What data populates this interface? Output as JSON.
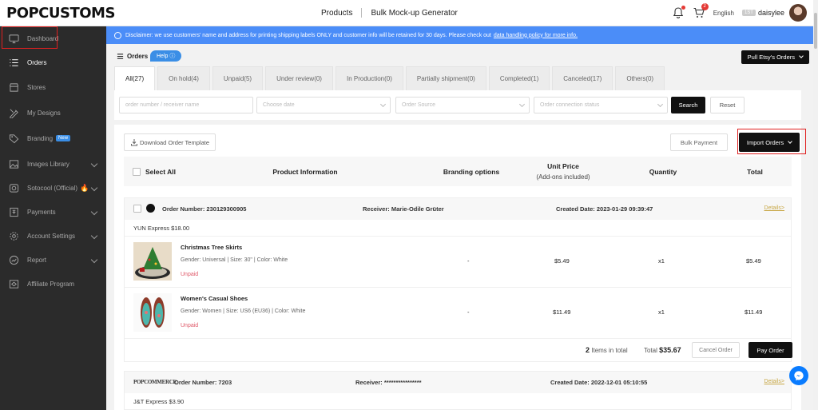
{
  "brand": {
    "logo": "POPCUSTOMS"
  },
  "topnav": {
    "products": "Products",
    "mockup": "Bulk Mock-up Generator"
  },
  "topright": {
    "language": "English",
    "user_tag": "1ST",
    "username": "daisylee",
    "cart_count": "2"
  },
  "sidebar": {
    "items": [
      {
        "label": "Dashboard",
        "icon": "monitor-icon"
      },
      {
        "label": "Orders",
        "icon": "list-icon"
      },
      {
        "label": "Stores",
        "icon": "store-icon"
      },
      {
        "label": "My Designs",
        "icon": "design-icon"
      },
      {
        "label": "Branding",
        "icon": "tag-icon",
        "badge": "New"
      },
      {
        "label": "Images Library",
        "icon": "image-icon"
      },
      {
        "label": "Sotocool (Official)",
        "icon": "coin-icon"
      },
      {
        "label": "Payments",
        "icon": "payment-icon"
      },
      {
        "label": "Account Settings",
        "icon": "gear-icon"
      },
      {
        "label": "Report",
        "icon": "report-icon"
      },
      {
        "label": "Affiliate Program",
        "icon": "affiliate-icon"
      }
    ]
  },
  "disclaimer": {
    "text": "Disclaimer: we use customers' name and address for printing shipping labels ONLY and customer info will be retained for 30 days. Please check out",
    "link": "data handling policy for more info."
  },
  "header": {
    "title": "Orders",
    "help": "Help",
    "pull_btn": "Pull Etsy's Orders"
  },
  "tabs": [
    {
      "label": "All(27)"
    },
    {
      "label": "On hold(4)"
    },
    {
      "label": "Unpaid(5)"
    },
    {
      "label": "Under review(0)"
    },
    {
      "label": "In Production(0)"
    },
    {
      "label": "Partially shipment(0)"
    },
    {
      "label": "Completed(1)"
    },
    {
      "label": "Canceled(17)"
    },
    {
      "label": "Others(0)"
    }
  ],
  "filters": {
    "order_number_placeholder": "order number / receiver name",
    "date_placeholder": "Choose date",
    "source_placeholder": "Order Source",
    "status_placeholder": "Order connection status",
    "search": "Search",
    "reset": "Reset"
  },
  "actions": {
    "download": "Download Order Template",
    "bulk_payment": "Bulk Payment",
    "import": "Import Orders"
  },
  "table_head": {
    "select_all": "Select All",
    "product": "Product Information",
    "branding": "Branding options",
    "unit_price": "Unit Price",
    "addons": "(Add-ons included)",
    "quantity": "Quantity",
    "total": "Total"
  },
  "orders": [
    {
      "number": "Order Number: 230129300905",
      "receiver": "Receiver: Marie-Odile Grüter",
      "created": "Created Date: 2023-01-29 09:39:47",
      "details": "Details>",
      "shipping": "YUN Express $18.00",
      "items": [
        {
          "name": "Christmas Tree Skirts",
          "desc": "Gender: Universal | Size: 30\" | Color: White",
          "status": "Unpaid",
          "branding": "-",
          "price": "$5.49",
          "qty": "x1",
          "total": "$5.49"
        },
        {
          "name": "Women's Casual Shoes",
          "desc": "Gender: Women | Size: US6 (EU36) | Color: White",
          "status": "Unpaid",
          "branding": "-",
          "price": "$11.49",
          "qty": "x1",
          "total": "$11.49"
        }
      ],
      "items_count": "2",
      "items_label": "Items in total",
      "total_label": "Total",
      "total_value": "$35.67",
      "cancel": "Cancel Order",
      "pay": "Pay Order"
    },
    {
      "source_logo": "POPCOMMERCE",
      "number": "Order Number: 7203",
      "receiver": "Receiver: ****************",
      "created": "Created Date: 2022-12-01 05:10:55",
      "details": "Details>",
      "shipping": "J&T Express $3.90"
    }
  ]
}
